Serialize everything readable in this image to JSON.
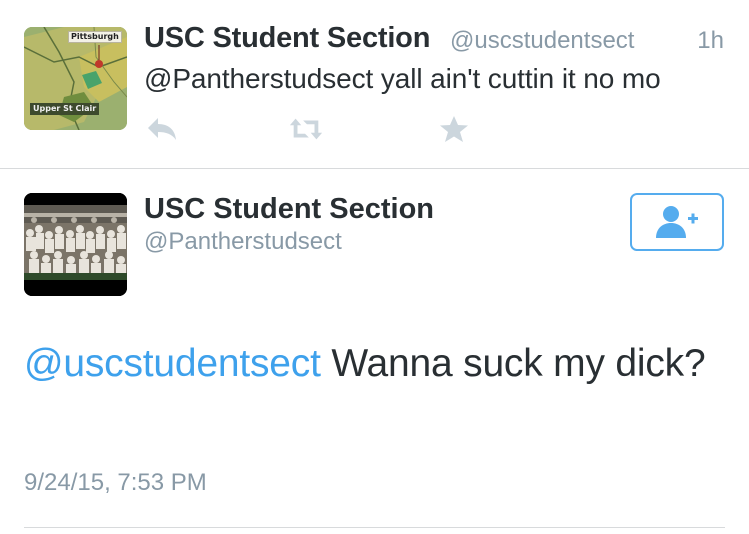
{
  "top_tweet": {
    "author_name": "USC Student Section",
    "author_handle": "@uscstudentsect",
    "time_ago": "1h",
    "text": "@Pantherstudsect yall ain't cuttin it no mo",
    "avatar": {
      "map_label_top": "Pittsburgh",
      "map_label_bottom": "Upper St Clair"
    },
    "actions": {
      "reply_icon": "reply-icon",
      "retweet_icon": "retweet-icon",
      "favorite_icon": "star-icon"
    }
  },
  "main_tweet": {
    "author_name": "USC Student Section",
    "author_handle": "@Pantherstudsect",
    "mention": "@uscstudentsect",
    "text": " Wanna suck my dick?",
    "timestamp": "9/24/15, 7:53 PM",
    "follow_icon": "add-user-icon"
  },
  "colors": {
    "link_blue": "#3ea1ec",
    "follow_blue": "#55acee",
    "meta_gray": "#8899a6",
    "action_gray": "#ccd6dd",
    "text_dark": "#292f33"
  }
}
